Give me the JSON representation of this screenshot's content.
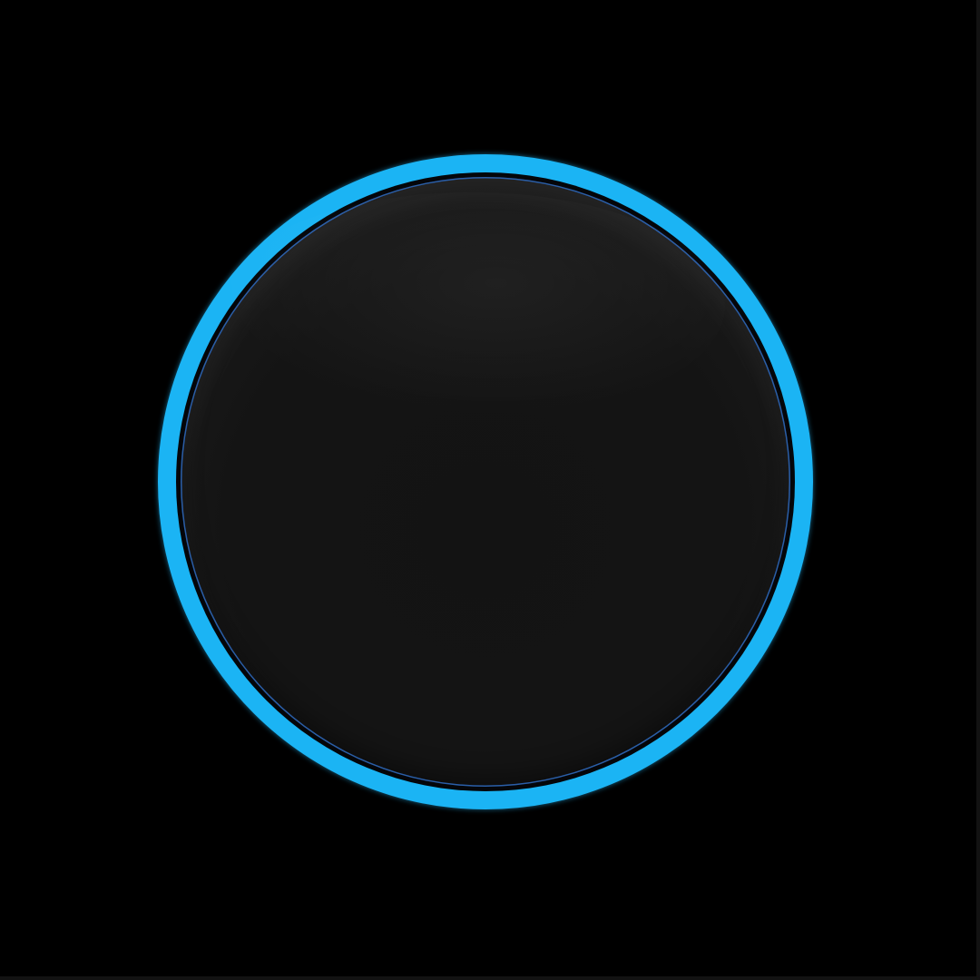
{
  "colors": {
    "background": "#000000",
    "ring": "#1bb4f4",
    "orb": "#141414",
    "orb_rim": "#2a5ea8"
  },
  "icons": {
    "ring": "glowing-ring-icon",
    "orb": "dark-orb-button"
  }
}
